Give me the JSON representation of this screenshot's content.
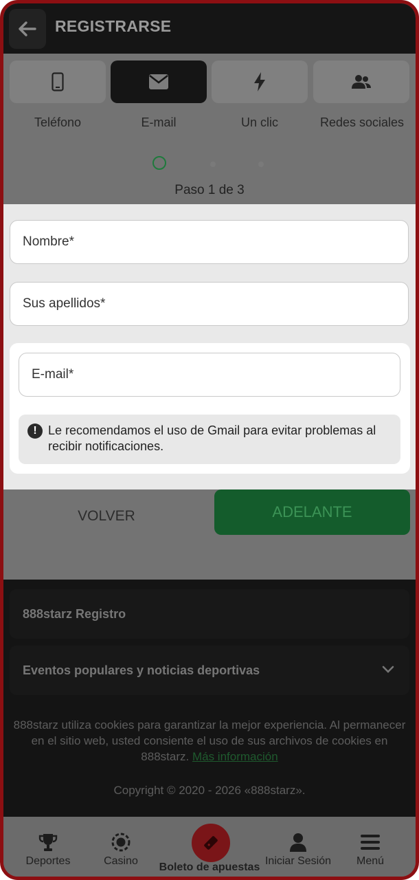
{
  "header": {
    "title": "REGISTRARSE"
  },
  "tabs": [
    {
      "label": "Teléfono",
      "icon": "phone-icon"
    },
    {
      "label": "E-mail",
      "icon": "envelope-icon",
      "active": true
    },
    {
      "label": "Un clic",
      "icon": "lightning-icon"
    },
    {
      "label": "Redes sociales",
      "icon": "users-icon"
    }
  ],
  "steps": {
    "label": "Paso 1 de 3",
    "current": 1,
    "total": 3
  },
  "form": {
    "first_name_placeholder": "Nombre*",
    "last_name_placeholder": "Sus apellidos*",
    "email_placeholder": "E-mail*",
    "notice": "Le recomendamos el uso de Gmail para evitar problemas al recibir notificaciones."
  },
  "buttons": {
    "back": "VOLVER",
    "next": "ADELANTE"
  },
  "footer": {
    "registro": "888starz Registro",
    "events": "Eventos populares y noticias deportivas",
    "cookie_text": "888starz utiliza cookies para garantizar la mejor experiencia. Al permanecer en el sitio web, usted consiente el uso de sus archivos de cookies en 888starz.",
    "cookie_link": "Más información",
    "copyright": "Copyright © 2020 - 2026 «888starz»."
  },
  "nav": {
    "sports": "Deportes",
    "casino": "Casino",
    "betslip": "Boleto de apuestas",
    "login": "Iniciar Sesión",
    "menu": "Menú"
  },
  "colors": {
    "brand_red": "#8c0f12",
    "accent_green": "#1e7a3c"
  }
}
